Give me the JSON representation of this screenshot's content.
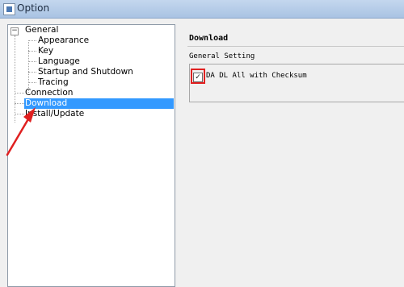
{
  "window": {
    "title": "Option"
  },
  "tree": {
    "items": [
      {
        "label": "General"
      },
      {
        "label": "Appearance"
      },
      {
        "label": "Key"
      },
      {
        "label": "Language"
      },
      {
        "label": "Startup and Shutdown"
      },
      {
        "label": "Tracing"
      },
      {
        "label": "Connection"
      },
      {
        "label": "Download",
        "selected": true
      },
      {
        "label": "Install/Update"
      }
    ],
    "expander_symbol": "−"
  },
  "panel": {
    "title": "Download",
    "group_label": "General Setting",
    "checkbox": {
      "label": "DA DL All with Checksum",
      "checked": true,
      "mark": "✓"
    }
  },
  "annotation": {
    "color": "#e02020"
  }
}
